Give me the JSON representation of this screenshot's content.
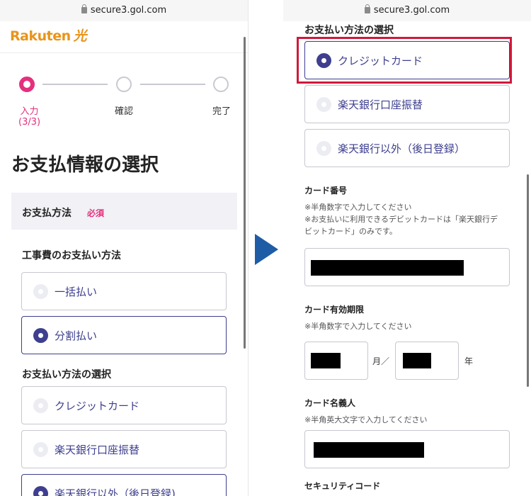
{
  "url": "secure3.gol.com",
  "left": {
    "logo": "Rakuten",
    "logo_sub": "光",
    "steps": [
      {
        "label": "入力",
        "sub": "(3/3)"
      },
      {
        "label": "確認"
      },
      {
        "label": "完了"
      }
    ],
    "page_title": "お支払情報の選択",
    "section_title": "お支払方法",
    "required_badge": "必須",
    "construction_fee_heading": "工事費のお支払い方法",
    "construction_options": [
      "一括払い",
      "分割払い"
    ],
    "payment_method_heading": "お支払い方法の選択",
    "payment_options": [
      "クレジットカード",
      "楽天銀行口座振替",
      "楽天銀行以外（後日登録)"
    ]
  },
  "right": {
    "payment_method_heading": "お支払い方法の選択",
    "payment_options": [
      "クレジットカード",
      "楽天銀行口座振替",
      "楽天銀行以外（後日登録）"
    ],
    "card_number_label": "カード番号",
    "card_number_note_1": "※半角数字で入力してください",
    "card_number_note_2": "※お支払いに利用できるデビットカードは「楽天銀行デ",
    "card_number_note_3": "ビットカード」のみです。",
    "expiry_label": "カード有効期限",
    "expiry_note": "※半角数字で入力してください",
    "expiry_month_unit": "月／",
    "expiry_year_unit": "年",
    "holder_label": "カード名義人",
    "holder_note": "※半角英大文字で入力してください",
    "security_label": "セキュリティコード"
  },
  "colors": {
    "brand": "#e8941a",
    "accent_pink": "#e4307d",
    "selected_indigo": "#3e3f8f",
    "highlight_red": "#d0193b",
    "arrow_blue": "#1f5ca6"
  }
}
